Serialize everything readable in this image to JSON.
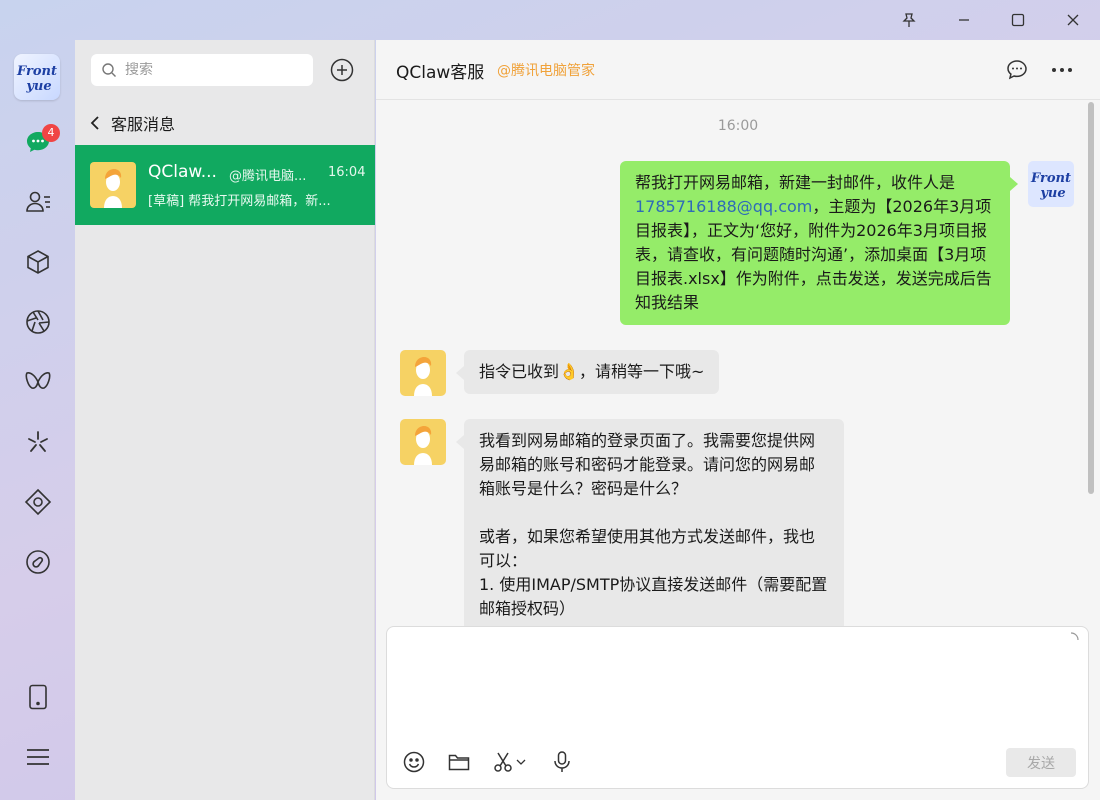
{
  "window": {
    "pin_icon": "pin-icon",
    "minimize_icon": "minimize-icon",
    "maximize_icon": "maximize-icon",
    "close_icon": "close-icon"
  },
  "rail": {
    "profile_text_1": "Front",
    "profile_text_2": "yue",
    "chat_badge": "4",
    "items": [
      "chat-icon",
      "contacts-icon",
      "cube-icon",
      "aperture-icon",
      "butterfly-icon",
      "sparkle-icon",
      "diamond-icon",
      "disc-icon",
      "phone-icon",
      "menu-icon"
    ]
  },
  "list": {
    "search_placeholder": "搜索",
    "back_label": "客服消息",
    "conversation": {
      "name": "QClaw...",
      "org": "@腾讯电脑...",
      "time": "16:04",
      "preview": "[草稿] 帮我打开网易邮箱，新..."
    }
  },
  "chat": {
    "title": "QClaw客服",
    "org": "@腾讯电脑管家",
    "timestamp": "16:00",
    "messages": [
      {
        "from": "me",
        "text_before": "帮我打开网易邮箱，新建一封邮件，收件人是",
        "email": "1785716188@qq.com",
        "text_after": "，主题为【2026年3月项目报表】，正文为‘您好，附件为2026年3月项目报表，请查收，有问题随时沟通’，添加桌面【3月项目报表.xlsx】作为附件，点击发送，发送完成后告知我结果"
      },
      {
        "from": "them",
        "text_before": "指令已收到",
        "emoji": "👌",
        "text_after": "，请稍等一下哦~"
      },
      {
        "from": "them",
        "para1": "我看到网易邮箱的登录页面了。我需要您提供网易邮箱的账号和密码才能登录。请问您的网易邮箱账号是什么？密码是什么？",
        "para2": "或者，如果您希望使用其他方式发送邮件，我也可以：",
        "item1": "1. 使用IMAP/SMTP协议直接发送邮件（需要配置邮箱授权码）"
      }
    ],
    "send_label": "发送"
  }
}
